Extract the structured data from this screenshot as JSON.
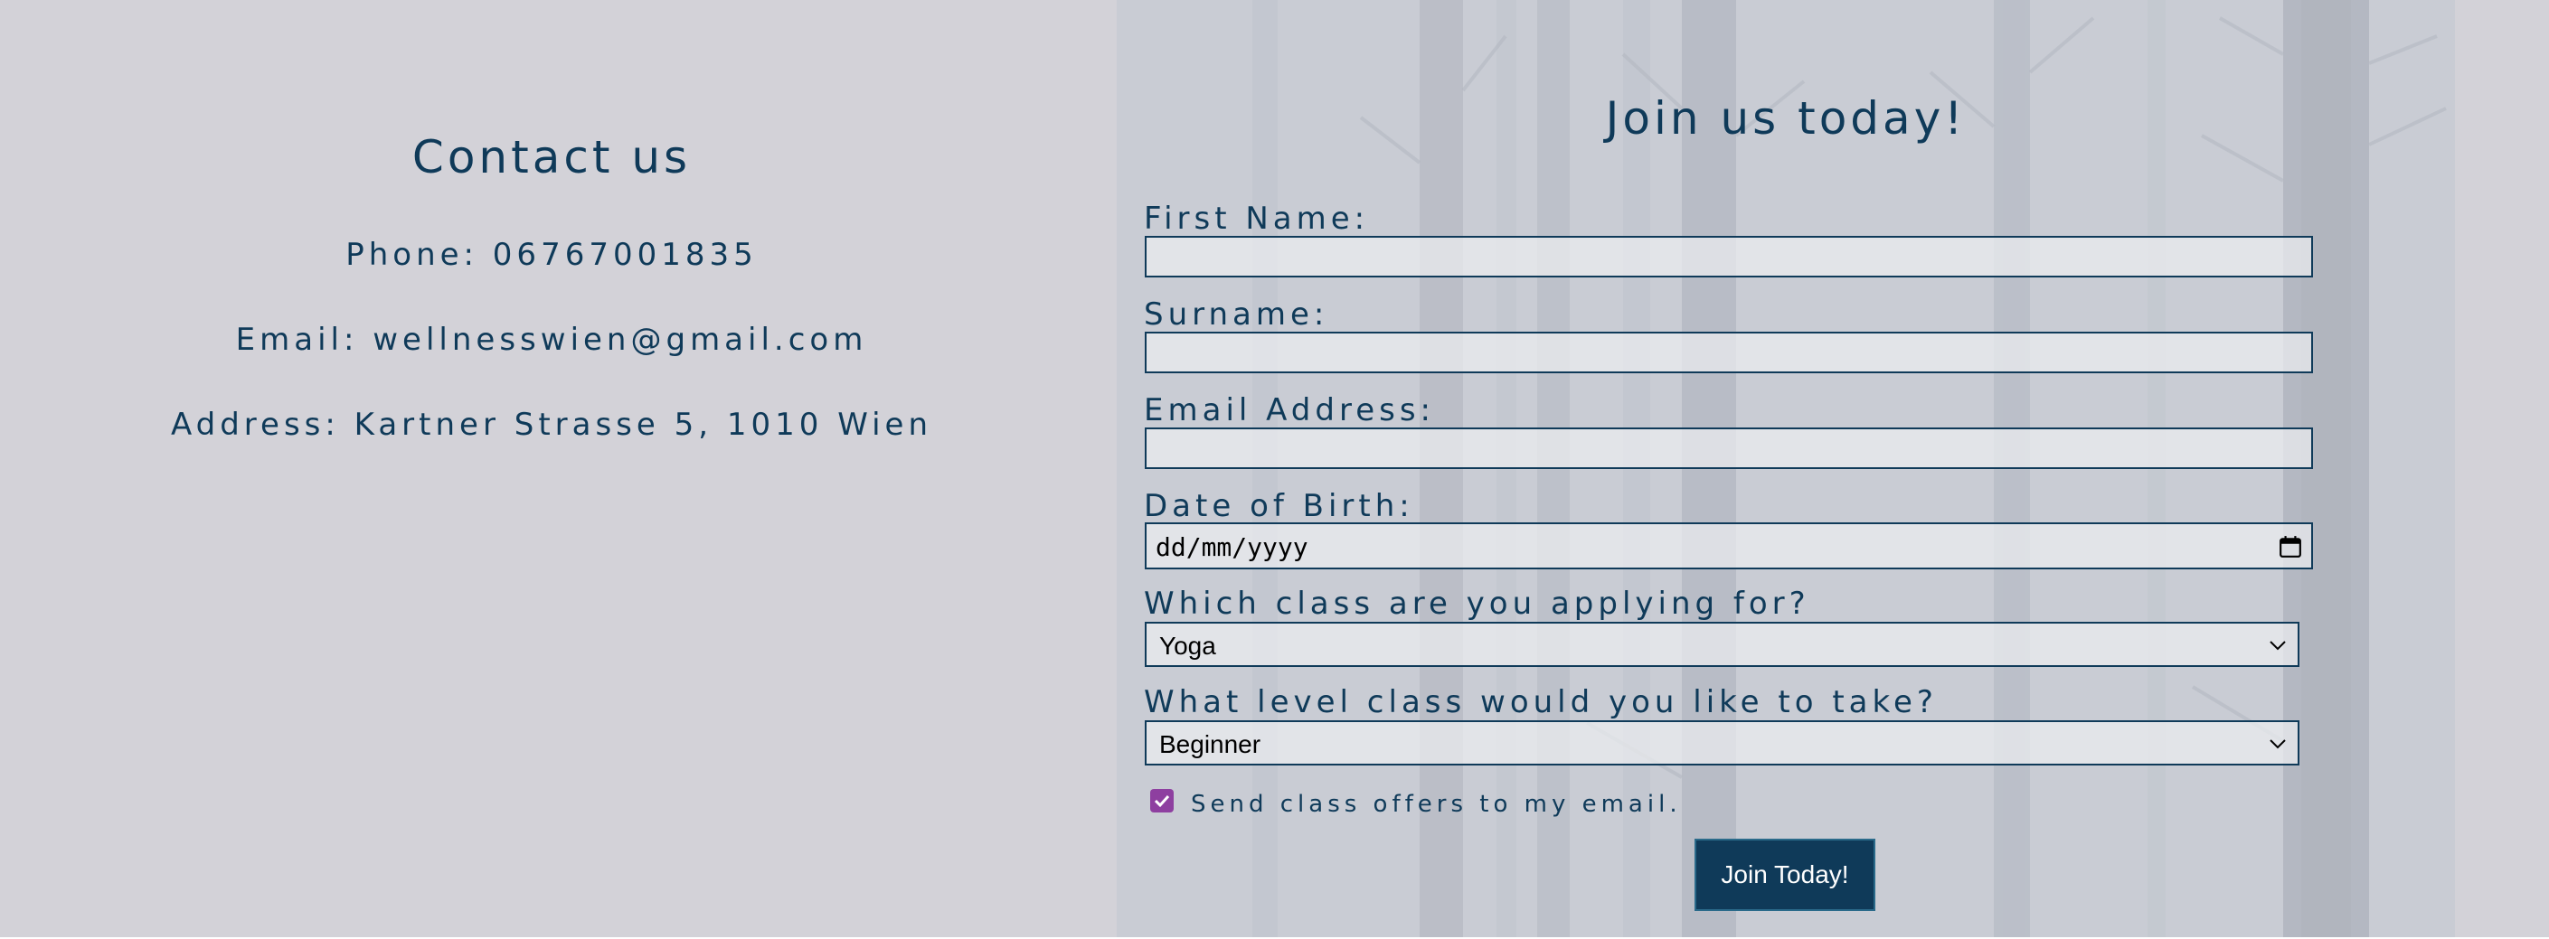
{
  "contact": {
    "title": "Contact us",
    "phone": "Phone: 06767001835",
    "email": "Email: wellnesswien@gmail.com",
    "address": "Address: Kartner Strasse 5, 1010 Wien"
  },
  "form": {
    "title": "Join us today!",
    "first_name_label": "First Name:",
    "first_name_value": "",
    "surname_label": "Surname:",
    "surname_value": "",
    "email_label": "Email Address:",
    "email_value": "",
    "dob_label": "Date of Birth:",
    "dob_placeholder": "dd/mm/yyyy",
    "class_label": "Which class are you applying for?",
    "class_selected": "Yoga",
    "level_label": "What level class would you like to take?",
    "level_selected": "Beginner",
    "offers_label": "Send class offers to my email.",
    "offers_checked": true,
    "submit_label": "Join Today!"
  },
  "colors": {
    "text_primary": "#0f3a59",
    "left_background": "#d3d2d8",
    "button_background": "#0f3a59",
    "checkbox_accent": "#8e3fa0"
  },
  "icons": {
    "date_picker": "calendar-icon",
    "select_arrow": "chevron-down-icon",
    "checkbox": "checkmark-icon"
  }
}
